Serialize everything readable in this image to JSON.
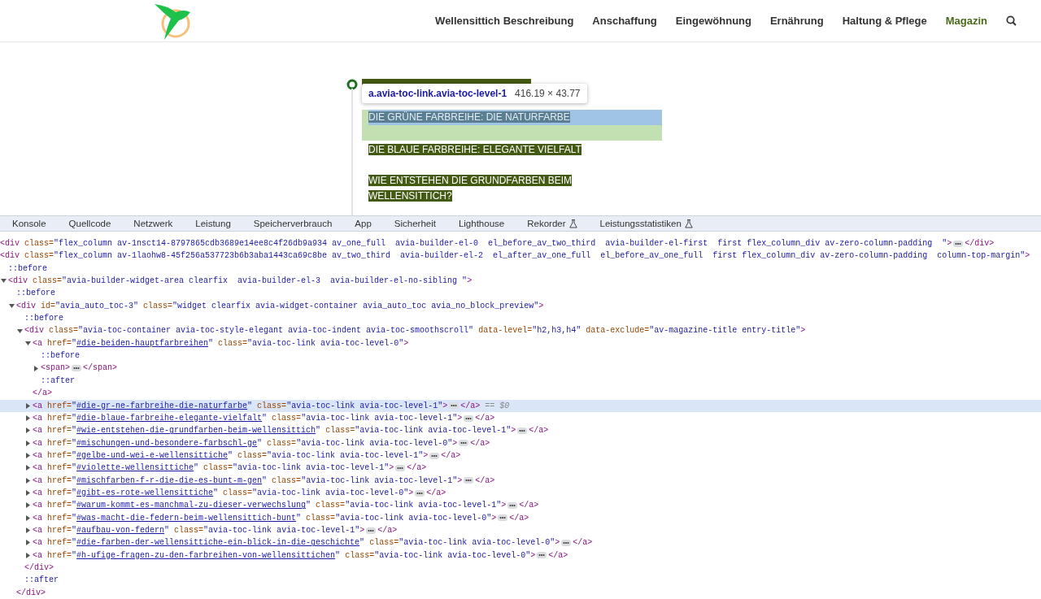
{
  "header": {
    "nav": [
      {
        "label": "Wellensittich Beschreibung",
        "selected": false
      },
      {
        "label": "Anschaffung",
        "selected": false
      },
      {
        "label": "Eingewöhnung",
        "selected": false
      },
      {
        "label": "Ernährung",
        "selected": false
      },
      {
        "label": "Haltung & Pflege",
        "selected": false
      },
      {
        "label": "Magazin",
        "selected": true
      }
    ]
  },
  "toc": {
    "items": [
      {
        "kind": "covered",
        "highlighted": false
      },
      {
        "kind": "link",
        "text": "DIE GRÜNE FARBREIHE: DIE NATURFARBE",
        "highlighted": true
      },
      {
        "kind": "link",
        "text": "DIE BLAUE FARBREIHE: ELEGANTE VIELFALT",
        "highlighted": false
      },
      {
        "kind": "link",
        "text": "WIE ENTSTEHEN DIE GRUNDFARBEN BEIM WELLENSITTICH?",
        "highlighted": false
      }
    ],
    "tooltip": {
      "selector": "a.avia-toc-link.avia-toc-level-1",
      "size": "416.19 × 43.77"
    }
  },
  "devtools": {
    "tabs": [
      {
        "label": "Konsole",
        "experimental": false
      },
      {
        "label": "Quellcode",
        "experimental": false
      },
      {
        "label": "Netzwerk",
        "experimental": false
      },
      {
        "label": "Leistung",
        "experimental": false
      },
      {
        "label": "Speicherverbrauch",
        "experimental": false
      },
      {
        "label": "App",
        "experimental": false
      },
      {
        "label": "Sicherheit",
        "experimental": false
      },
      {
        "label": "Lighthouse",
        "experimental": false
      },
      {
        "label": "Rekorder",
        "experimental": true
      },
      {
        "label": "Leistungsstatistiken",
        "experimental": true
      }
    ],
    "nodes": [
      {
        "selected": false,
        "segments": [
          {
            "kind": "tag",
            "text": "<div"
          },
          {
            "kind": "attr",
            "text": " class="
          },
          {
            "kind": "value",
            "text": "\"flex_column av-1nsct14-8797865cdb3689e14ee8c4f26db9a934 av_one_full  avia-builder-el-0  el_before_av_two_third  avia-builder-el-first  first flex_column_div av-zero-column-padding  \""
          },
          {
            "kind": "tag",
            "text": ">"
          },
          {
            "kind": "ellipsis"
          },
          {
            "kind": "tag",
            "text": "</div>"
          }
        ]
      },
      {
        "selected": false,
        "segments": [
          {
            "kind": "tag",
            "text": "<div"
          },
          {
            "kind": "attr",
            "text": " class="
          },
          {
            "kind": "value",
            "text": "\"flex_column av-1laohw8-45f256a537723b6b3aba1443ca69c8be av_two_third  avia-builder-el-2  el_after_av_one_full  el_before_av_one_full  first flex_column_div av-zero-column-padding  column-top-margin\""
          },
          {
            "kind": "tag",
            "text": ">"
          }
        ],
        "children": [
          {
            "selected": false,
            "segments": [
              {
                "kind": "pseudo",
                "text": "::before"
              }
            ]
          },
          {
            "selected": false,
            "expanded": true,
            "segments": [
              {
                "kind": "tag",
                "text": "<div"
              },
              {
                "kind": "attr",
                "text": " class="
              },
              {
                "kind": "value",
                "text": "\"avia-builder-widget-area clearfix  avia-builder-el-3  avia-builder-el-no-sibling \""
              },
              {
                "kind": "tag",
                "text": ">"
              }
            ],
            "children": [
              {
                "selected": false,
                "segments": [
                  {
                    "kind": "pseudo",
                    "text": "::before"
                  }
                ]
              },
              {
                "selected": false,
                "expanded": true,
                "segments": [
                  {
                    "kind": "tag",
                    "text": "<div"
                  },
                  {
                    "kind": "attr",
                    "text": " id="
                  },
                  {
                    "kind": "value",
                    "text": "\"avia_auto_toc-3\""
                  },
                  {
                    "kind": "attr",
                    "text": " class="
                  },
                  {
                    "kind": "value",
                    "text": "\"widget clearfix avia-widget-container avia_auto_toc avia_no_block_preview\""
                  },
                  {
                    "kind": "tag",
                    "text": ">"
                  }
                ],
                "children": [
                  {
                    "selected": false,
                    "segments": [
                      {
                        "kind": "pseudo",
                        "text": "::before"
                      }
                    ]
                  },
                  {
                    "selected": false,
                    "expanded": true,
                    "segments": [
                      {
                        "kind": "tag",
                        "text": "<div"
                      },
                      {
                        "kind": "attr",
                        "text": " class="
                      },
                      {
                        "kind": "value",
                        "text": "\"avia-toc-container avia-toc-style-elegant avia-toc-indent avia-toc-smoothscroll\""
                      },
                      {
                        "kind": "attr",
                        "text": " data-level="
                      },
                      {
                        "kind": "value",
                        "text": "\"h2,h3,h4\""
                      },
                      {
                        "kind": "attr",
                        "text": " data-exclude="
                      },
                      {
                        "kind": "value",
                        "text": "\"av-magazine-title entry-title\""
                      },
                      {
                        "kind": "tag",
                        "text": ">"
                      }
                    ],
                    "children": [
                      {
                        "selected": false,
                        "expanded": true,
                        "segments": [
                          {
                            "kind": "tag",
                            "text": "<a"
                          },
                          {
                            "kind": "attr",
                            "text": " href="
                          },
                          {
                            "kind": "value",
                            "text": "\""
                          },
                          {
                            "kind": "link",
                            "text": "#die-beiden-hauptfarbreihen"
                          },
                          {
                            "kind": "value",
                            "text": "\""
                          },
                          {
                            "kind": "attr",
                            "text": " class="
                          },
                          {
                            "kind": "value",
                            "text": "\"avia-toc-link avia-toc-level-0\""
                          },
                          {
                            "kind": "tag",
                            "text": ">"
                          }
                        ],
                        "children": [
                          {
                            "selected": false,
                            "segments": [
                              {
                                "kind": "pseudo",
                                "text": "::before"
                              }
                            ]
                          },
                          {
                            "selected": false,
                            "expanded": false,
                            "segments": [
                              {
                                "kind": "tag",
                                "text": "<span>"
                              },
                              {
                                "kind": "ellipsis"
                              },
                              {
                                "kind": "tag",
                                "text": "</span>"
                              }
                            ]
                          },
                          {
                            "selected": false,
                            "segments": [
                              {
                                "kind": "pseudo",
                                "text": "::after"
                              }
                            ]
                          }
                        ]
                      },
                      {
                        "selected": false,
                        "segments": [
                          {
                            "kind": "tag",
                            "text": "</a>"
                          }
                        ]
                      },
                      {
                        "selected": true,
                        "expanded": false,
                        "segments": [
                          {
                            "kind": "tag",
                            "text": "<a"
                          },
                          {
                            "kind": "attr",
                            "text": " href="
                          },
                          {
                            "kind": "value",
                            "text": "\""
                          },
                          {
                            "kind": "link",
                            "text": "#die-gr-ne-farbreihe-die-naturfarbe"
                          },
                          {
                            "kind": "value",
                            "text": "\""
                          },
                          {
                            "kind": "attr",
                            "text": " class="
                          },
                          {
                            "kind": "value",
                            "text": "\"avia-toc-link avia-toc-level-1\""
                          },
                          {
                            "kind": "tag",
                            "text": ">"
                          },
                          {
                            "kind": "ellipsis"
                          },
                          {
                            "kind": "tag",
                            "text": "</a>"
                          },
                          {
                            "kind": "marker",
                            "text": "== $0"
                          }
                        ]
                      },
                      {
                        "selected": false,
                        "expanded": false,
                        "segments": [
                          {
                            "kind": "tag",
                            "text": "<a"
                          },
                          {
                            "kind": "attr",
                            "text": " href="
                          },
                          {
                            "kind": "value",
                            "text": "\""
                          },
                          {
                            "kind": "link",
                            "text": "#die-blaue-farbreihe-elegante-vielfalt"
                          },
                          {
                            "kind": "value",
                            "text": "\""
                          },
                          {
                            "kind": "attr",
                            "text": " class="
                          },
                          {
                            "kind": "value",
                            "text": "\"avia-toc-link avia-toc-level-1\""
                          },
                          {
                            "kind": "tag",
                            "text": ">"
                          },
                          {
                            "kind": "ellipsis"
                          },
                          {
                            "kind": "tag",
                            "text": "</a>"
                          }
                        ]
                      },
                      {
                        "selected": false,
                        "expanded": false,
                        "segments": [
                          {
                            "kind": "tag",
                            "text": "<a"
                          },
                          {
                            "kind": "attr",
                            "text": " href="
                          },
                          {
                            "kind": "value",
                            "text": "\""
                          },
                          {
                            "kind": "link",
                            "text": "#wie-entstehen-die-grundfarben-beim-wellensittich"
                          },
                          {
                            "kind": "value",
                            "text": "\""
                          },
                          {
                            "kind": "attr",
                            "text": " class="
                          },
                          {
                            "kind": "value",
                            "text": "\"avia-toc-link avia-toc-level-1\""
                          },
                          {
                            "kind": "tag",
                            "text": ">"
                          },
                          {
                            "kind": "ellipsis"
                          },
                          {
                            "kind": "tag",
                            "text": "</a>"
                          }
                        ]
                      },
                      {
                        "selected": false,
                        "expanded": false,
                        "segments": [
                          {
                            "kind": "tag",
                            "text": "<a"
                          },
                          {
                            "kind": "attr",
                            "text": " href="
                          },
                          {
                            "kind": "value",
                            "text": "\""
                          },
                          {
                            "kind": "link",
                            "text": "#mischungen-und-besondere-farbschl-ge"
                          },
                          {
                            "kind": "value",
                            "text": "\""
                          },
                          {
                            "kind": "attr",
                            "text": " class="
                          },
                          {
                            "kind": "value",
                            "text": "\"avia-toc-link avia-toc-level-0\""
                          },
                          {
                            "kind": "tag",
                            "text": ">"
                          },
                          {
                            "kind": "ellipsis"
                          },
                          {
                            "kind": "tag",
                            "text": "</a>"
                          }
                        ]
                      },
                      {
                        "selected": false,
                        "expanded": false,
                        "segments": [
                          {
                            "kind": "tag",
                            "text": "<a"
                          },
                          {
                            "kind": "attr",
                            "text": " href="
                          },
                          {
                            "kind": "value",
                            "text": "\""
                          },
                          {
                            "kind": "link",
                            "text": "#gelbe-und-wei-e-wellensittiche"
                          },
                          {
                            "kind": "value",
                            "text": "\""
                          },
                          {
                            "kind": "attr",
                            "text": " class="
                          },
                          {
                            "kind": "value",
                            "text": "\"avia-toc-link avia-toc-level-1\""
                          },
                          {
                            "kind": "tag",
                            "text": ">"
                          },
                          {
                            "kind": "ellipsis"
                          },
                          {
                            "kind": "tag",
                            "text": "</a>"
                          }
                        ]
                      },
                      {
                        "selected": false,
                        "expanded": false,
                        "segments": [
                          {
                            "kind": "tag",
                            "text": "<a"
                          },
                          {
                            "kind": "attr",
                            "text": " href="
                          },
                          {
                            "kind": "value",
                            "text": "\""
                          },
                          {
                            "kind": "link",
                            "text": "#violette-wellensittiche"
                          },
                          {
                            "kind": "value",
                            "text": "\""
                          },
                          {
                            "kind": "attr",
                            "text": " class="
                          },
                          {
                            "kind": "value",
                            "text": "\"avia-toc-link avia-toc-level-1\""
                          },
                          {
                            "kind": "tag",
                            "text": ">"
                          },
                          {
                            "kind": "ellipsis"
                          },
                          {
                            "kind": "tag",
                            "text": "</a>"
                          }
                        ]
                      },
                      {
                        "selected": false,
                        "expanded": false,
                        "segments": [
                          {
                            "kind": "tag",
                            "text": "<a"
                          },
                          {
                            "kind": "attr",
                            "text": " href="
                          },
                          {
                            "kind": "value",
                            "text": "\""
                          },
                          {
                            "kind": "link",
                            "text": "#mischfarben-f-r-die-die-es-bunt-m-gen"
                          },
                          {
                            "kind": "value",
                            "text": "\""
                          },
                          {
                            "kind": "attr",
                            "text": " class="
                          },
                          {
                            "kind": "value",
                            "text": "\"avia-toc-link avia-toc-level-1\""
                          },
                          {
                            "kind": "tag",
                            "text": ">"
                          },
                          {
                            "kind": "ellipsis"
                          },
                          {
                            "kind": "tag",
                            "text": "</a>"
                          }
                        ]
                      },
                      {
                        "selected": false,
                        "expanded": false,
                        "segments": [
                          {
                            "kind": "tag",
                            "text": "<a"
                          },
                          {
                            "kind": "attr",
                            "text": " href="
                          },
                          {
                            "kind": "value",
                            "text": "\""
                          },
                          {
                            "kind": "link",
                            "text": "#gibt-es-rote-wellensittiche"
                          },
                          {
                            "kind": "value",
                            "text": "\""
                          },
                          {
                            "kind": "attr",
                            "text": " class="
                          },
                          {
                            "kind": "value",
                            "text": "\"avia-toc-link avia-toc-level-0\""
                          },
                          {
                            "kind": "tag",
                            "text": ">"
                          },
                          {
                            "kind": "ellipsis"
                          },
                          {
                            "kind": "tag",
                            "text": "</a>"
                          }
                        ]
                      },
                      {
                        "selected": false,
                        "expanded": false,
                        "segments": [
                          {
                            "kind": "tag",
                            "text": "<a"
                          },
                          {
                            "kind": "attr",
                            "text": " href="
                          },
                          {
                            "kind": "value",
                            "text": "\""
                          },
                          {
                            "kind": "link",
                            "text": "#warum-kommt-es-manchmal-zu-dieser-verwechslung"
                          },
                          {
                            "kind": "value",
                            "text": "\""
                          },
                          {
                            "kind": "attr",
                            "text": " class="
                          },
                          {
                            "kind": "value",
                            "text": "\"avia-toc-link avia-toc-level-1\""
                          },
                          {
                            "kind": "tag",
                            "text": ">"
                          },
                          {
                            "kind": "ellipsis"
                          },
                          {
                            "kind": "tag",
                            "text": "</a>"
                          }
                        ]
                      },
                      {
                        "selected": false,
                        "expanded": false,
                        "segments": [
                          {
                            "kind": "tag",
                            "text": "<a"
                          },
                          {
                            "kind": "attr",
                            "text": " href="
                          },
                          {
                            "kind": "value",
                            "text": "\""
                          },
                          {
                            "kind": "link",
                            "text": "#was-macht-die-federn-beim-wellensittich-bunt"
                          },
                          {
                            "kind": "value",
                            "text": "\""
                          },
                          {
                            "kind": "attr",
                            "text": " class="
                          },
                          {
                            "kind": "value",
                            "text": "\"avia-toc-link avia-toc-level-0\""
                          },
                          {
                            "kind": "tag",
                            "text": ">"
                          },
                          {
                            "kind": "ellipsis"
                          },
                          {
                            "kind": "tag",
                            "text": "</a>"
                          }
                        ]
                      },
                      {
                        "selected": false,
                        "expanded": false,
                        "segments": [
                          {
                            "kind": "tag",
                            "text": "<a"
                          },
                          {
                            "kind": "attr",
                            "text": " href="
                          },
                          {
                            "kind": "value",
                            "text": "\""
                          },
                          {
                            "kind": "link",
                            "text": "#aufbau-von-federn"
                          },
                          {
                            "kind": "value",
                            "text": "\""
                          },
                          {
                            "kind": "attr",
                            "text": " class="
                          },
                          {
                            "kind": "value",
                            "text": "\"avia-toc-link avia-toc-level-1\""
                          },
                          {
                            "kind": "tag",
                            "text": ">"
                          },
                          {
                            "kind": "ellipsis"
                          },
                          {
                            "kind": "tag",
                            "text": "</a>"
                          }
                        ]
                      },
                      {
                        "selected": false,
                        "expanded": false,
                        "segments": [
                          {
                            "kind": "tag",
                            "text": "<a"
                          },
                          {
                            "kind": "attr",
                            "text": " href="
                          },
                          {
                            "kind": "value",
                            "text": "\""
                          },
                          {
                            "kind": "link",
                            "text": "#die-farben-der-wellensittiche-ein-blick-in-die-geschichte"
                          },
                          {
                            "kind": "value",
                            "text": "\""
                          },
                          {
                            "kind": "attr",
                            "text": " class="
                          },
                          {
                            "kind": "value",
                            "text": "\"avia-toc-link avia-toc-level-0\""
                          },
                          {
                            "kind": "tag",
                            "text": ">"
                          },
                          {
                            "kind": "ellipsis"
                          },
                          {
                            "kind": "tag",
                            "text": "</a>"
                          }
                        ]
                      },
                      {
                        "selected": false,
                        "expanded": false,
                        "segments": [
                          {
                            "kind": "tag",
                            "text": "<a"
                          },
                          {
                            "kind": "attr",
                            "text": " href="
                          },
                          {
                            "kind": "value",
                            "text": "\""
                          },
                          {
                            "kind": "link",
                            "text": "#h-ufige-fragen-zu-den-farbreihen-von-wellensittichen"
                          },
                          {
                            "kind": "value",
                            "text": "\""
                          },
                          {
                            "kind": "attr",
                            "text": " class="
                          },
                          {
                            "kind": "value",
                            "text": "\"avia-toc-link avia-toc-level-0\""
                          },
                          {
                            "kind": "tag",
                            "text": ">"
                          },
                          {
                            "kind": "ellipsis"
                          },
                          {
                            "kind": "tag",
                            "text": "</a>"
                          }
                        ]
                      }
                    ]
                  },
                  {
                    "selected": false,
                    "segments": [
                      {
                        "kind": "tag",
                        "text": "</div>"
                      }
                    ]
                  },
                  {
                    "selected": false,
                    "segments": [
                      {
                        "kind": "pseudo",
                        "text": "::after"
                      }
                    ]
                  }
                ]
              },
              {
                "selected": false,
                "segments": [
                  {
                    "kind": "tag",
                    "text": "</div>"
                  }
                ]
              }
            ]
          }
        ]
      }
    ]
  }
}
